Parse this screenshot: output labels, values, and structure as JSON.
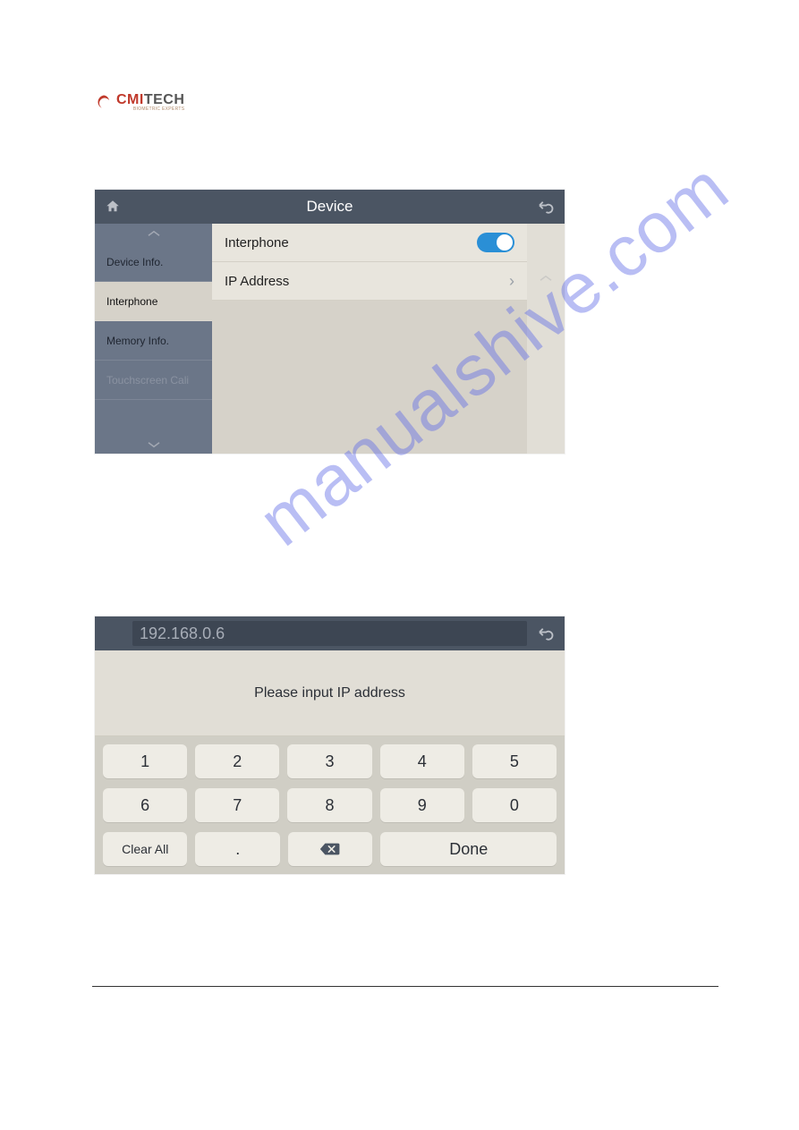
{
  "logo": {
    "text_prefix": "CMI",
    "text_suffix": "TECH",
    "subtitle": "BIOMETRIC EXPERTS"
  },
  "watermark": "manualshive.com",
  "screenshot_device": {
    "header_title": "Device",
    "sidebar": {
      "items": [
        {
          "label": "Device Info.",
          "state": "normal"
        },
        {
          "label": "Interphone",
          "state": "active"
        },
        {
          "label": "Memory Info.",
          "state": "normal"
        },
        {
          "label": "Touchscreen Cali",
          "state": "dim"
        }
      ]
    },
    "settings_rows": [
      {
        "label": "Interphone",
        "control": "toggle_on"
      },
      {
        "label": "IP Address",
        "control": "chevron"
      }
    ]
  },
  "screenshot_ipinput": {
    "input_value": "192.168.0.6",
    "prompt": "Please input IP address",
    "keys_row1": [
      "1",
      "2",
      "3",
      "4",
      "5"
    ],
    "keys_row2": [
      "6",
      "7",
      "8",
      "9",
      "0"
    ],
    "clear_label": "Clear All",
    "period_label": ".",
    "done_label": "Done"
  }
}
